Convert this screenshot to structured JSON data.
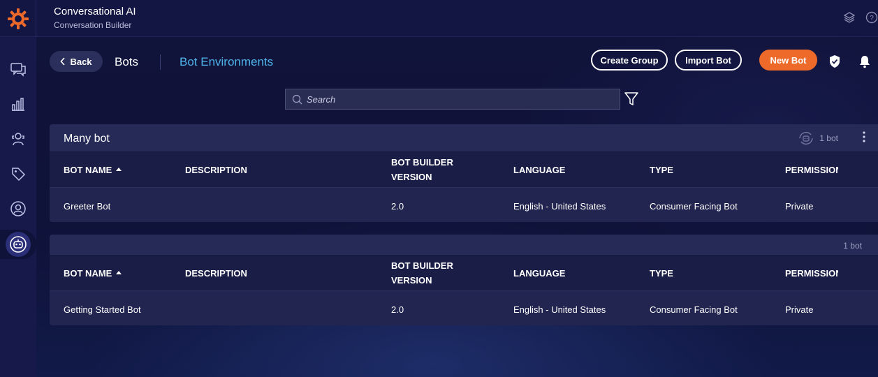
{
  "app": {
    "title": "Conversational AI",
    "subtitle": "Conversation Builder",
    "brand_color": "#ee6a2a"
  },
  "top_icons": [
    "layers-icon",
    "help-icon"
  ],
  "sidebar": {
    "items": [
      {
        "icon": "chat-icon"
      },
      {
        "icon": "chart-icon"
      },
      {
        "icon": "agent-icon"
      },
      {
        "icon": "tag-icon"
      },
      {
        "icon": "user-icon"
      },
      {
        "icon": "bot-icon",
        "active": true
      }
    ]
  },
  "toolbar": {
    "back_label": "Back",
    "breadcrumb_bots": "Bots",
    "breadcrumb_env": "Bot Environments",
    "create_group_label": "Create Group",
    "import_bot_label": "Import Bot",
    "new_bot_label": "New Bot"
  },
  "search": {
    "placeholder": "Search",
    "value": ""
  },
  "columns": [
    "BOT NAME",
    "DESCRIPTION",
    "BOT BUILDER",
    "VERSION",
    "LANGUAGE",
    "TYPE",
    "PERMISSIONS"
  ],
  "groups": [
    {
      "name": "Many bot",
      "count": "1 bot",
      "rows": [
        {
          "name": "Greeter Bot",
          "description": "",
          "version": "2.0",
          "language": "English - United States",
          "type": "Consumer Facing Bot",
          "permission": "Private"
        }
      ]
    },
    {
      "name": "",
      "count": "1 bot",
      "rows": [
        {
          "name": "Getting Started Bot",
          "description": "",
          "version": "2.0",
          "language": "English - United States",
          "type": "Consumer Facing Bot",
          "permission": "Private"
        }
      ]
    }
  ]
}
